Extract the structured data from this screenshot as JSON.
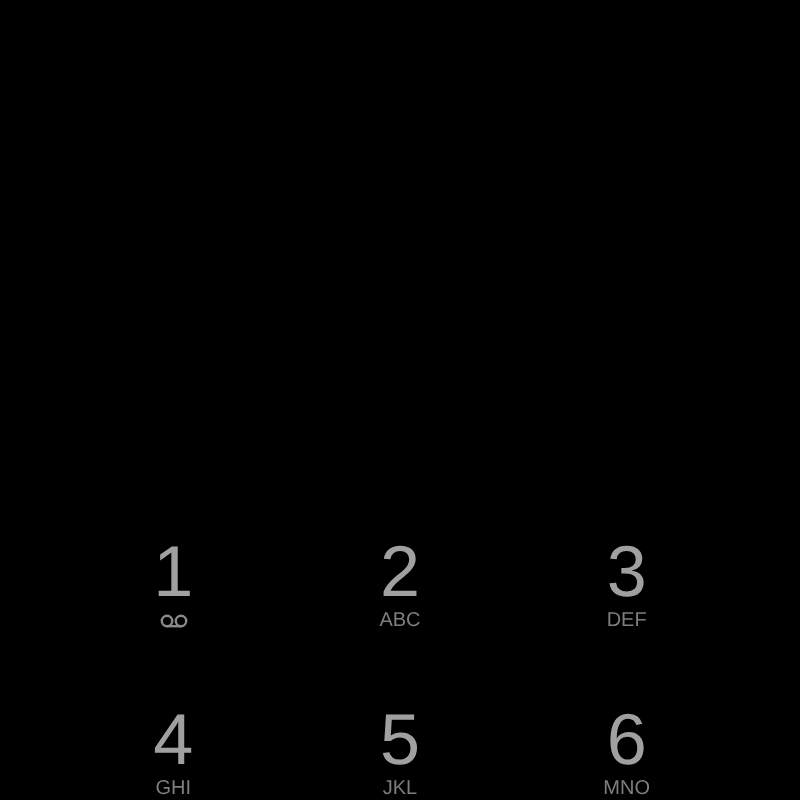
{
  "dialpad": {
    "keys": [
      {
        "digit": "1",
        "kind": "voicemail"
      },
      {
        "digit": "2",
        "kind": "letters",
        "letters": "ABC"
      },
      {
        "digit": "3",
        "kind": "letters",
        "letters": "DEF"
      },
      {
        "digit": "4",
        "kind": "letters",
        "letters": "GHI"
      },
      {
        "digit": "5",
        "kind": "letters",
        "letters": "JKL"
      },
      {
        "digit": "6",
        "kind": "letters",
        "letters": "MNO"
      }
    ]
  }
}
